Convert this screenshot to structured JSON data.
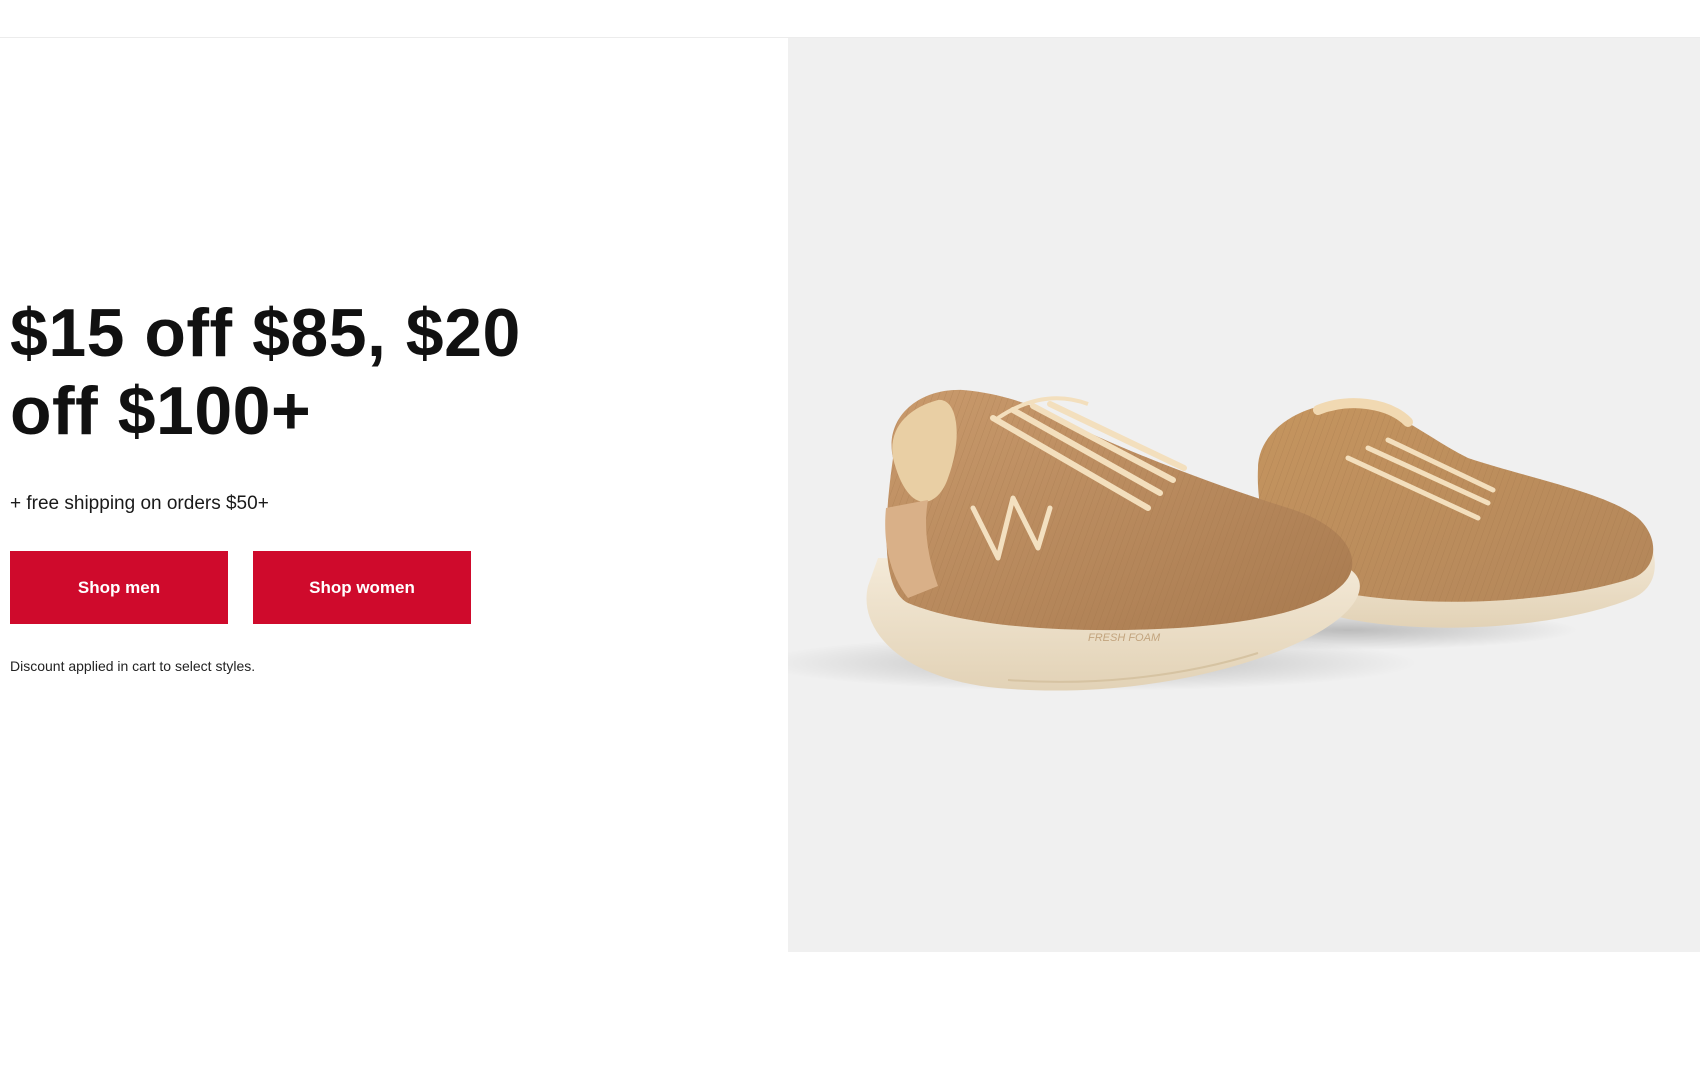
{
  "hero": {
    "headline": "$15 off $85, $20 off $100+",
    "subline": "+ free shipping on orders $50+",
    "buttons": {
      "shop_men": "Shop men",
      "shop_women": "Shop women"
    },
    "disclaimer": "Discount applied in cart to select styles.",
    "image": {
      "subject": "pair of tan running shoes",
      "midsole_print": "FRESH FOAM"
    }
  },
  "colors": {
    "button_bg": "#cf0a2c",
    "button_text": "#ffffff",
    "image_bg": "#f0f0f0",
    "shoe_upper": "#b98a5e",
    "shoe_midsole": "#efe2cc"
  }
}
